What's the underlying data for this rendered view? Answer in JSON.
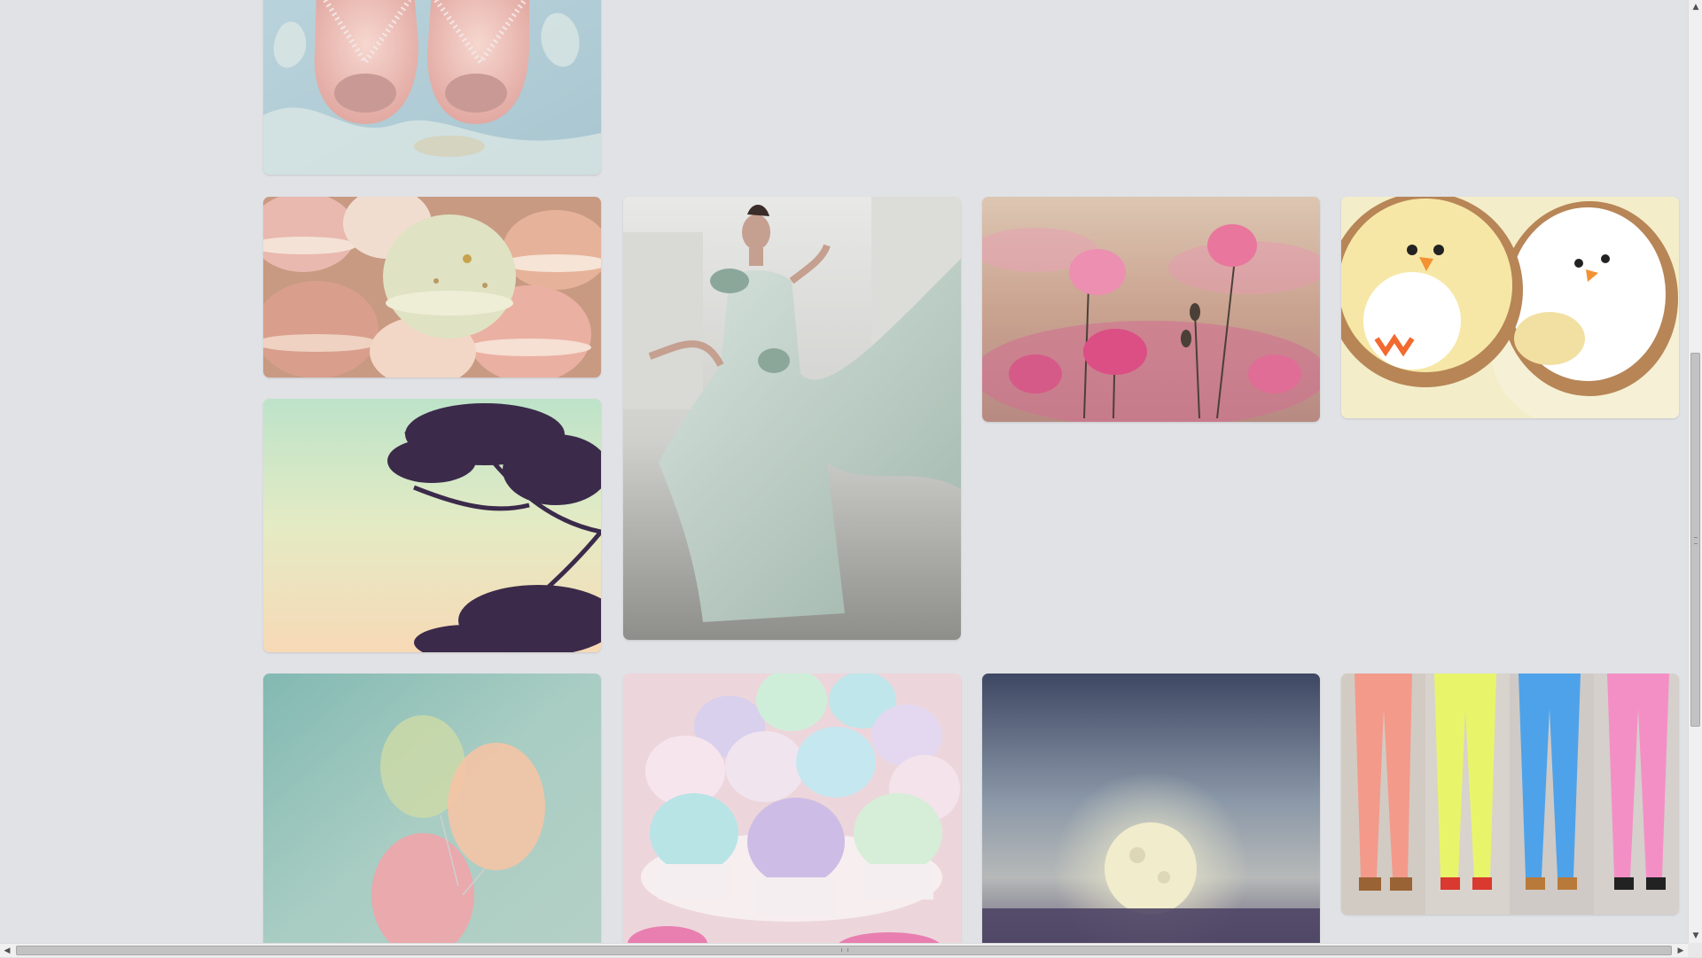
{
  "page": {
    "background": "#e1e2e6"
  },
  "pins": [
    {
      "name": "pin-pink-shoes",
      "image": "pink-satin-peep-toe-shoes"
    },
    {
      "name": "pin-macarons",
      "image": "pastel-macarons"
    },
    {
      "name": "pin-tree-silhouette",
      "image": "tree-silhouette-pastel-sky"
    },
    {
      "name": "pin-flowing-gown",
      "image": "woman-mint-flowing-gown"
    },
    {
      "name": "pin-pink-poppies",
      "image": "pink-poppy-field"
    },
    {
      "name": "pin-bird-cookies",
      "image": "bird-sugar-cookies"
    },
    {
      "name": "pin-pastel-balloons",
      "image": "pastel-balloons"
    },
    {
      "name": "pin-sugar-cupcakes",
      "image": "pastel-sugar-cupcakes"
    },
    {
      "name": "pin-full-moon",
      "image": "full-moon-over-sea"
    },
    {
      "name": "pin-colored-jeans",
      "image": "pastel-colored-jeans"
    }
  ],
  "scrollbars": {
    "vertical": {
      "up_icon": "arrow-up-icon",
      "down_icon": "arrow-down-icon"
    },
    "horizontal": {
      "left_icon": "arrow-left-icon",
      "right_icon": "arrow-right-icon"
    }
  }
}
